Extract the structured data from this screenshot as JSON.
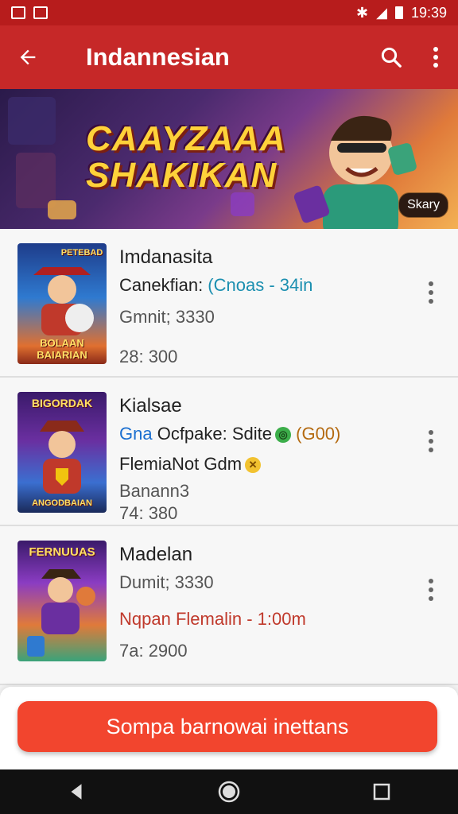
{
  "status_bar": {
    "time": "19:39"
  },
  "app_bar": {
    "title": "Indannesian"
  },
  "banner": {
    "title_line1": "CAAYZAAA",
    "title_line2": "SHAKIKAN",
    "badge": "Skary"
  },
  "items": [
    {
      "thumb_top": "PETEBAD",
      "thumb_bottom": "BOLAAN BAIARIAN",
      "title": "Imdanasita",
      "line2_label": "Canekfian: ",
      "line2_value": "(Cnoas - 34in",
      "line3": "Gmnit; 3330",
      "line4": "28: 300"
    },
    {
      "thumb_top": "BIGORDAK",
      "thumb_bottom": "ANGODBAIAN",
      "title": "Kialsae",
      "line2_a": "Gna ",
      "line2_b": "Ocfpake: Sdite",
      "line2_c": " (G00)",
      "line3": "FlemiaNot Gdm",
      "line3b": "Banann3",
      "line4": "74: 380"
    },
    {
      "thumb_top": "FERNUUAS",
      "thumb_bottom": "",
      "title": "Madelan",
      "line2": "Dumit; 3330",
      "line3": "Nqpan Flemalin - 1:00m",
      "line4": "7a: 2900"
    }
  ],
  "action": {
    "label": "Sompa barnowai inettans"
  }
}
